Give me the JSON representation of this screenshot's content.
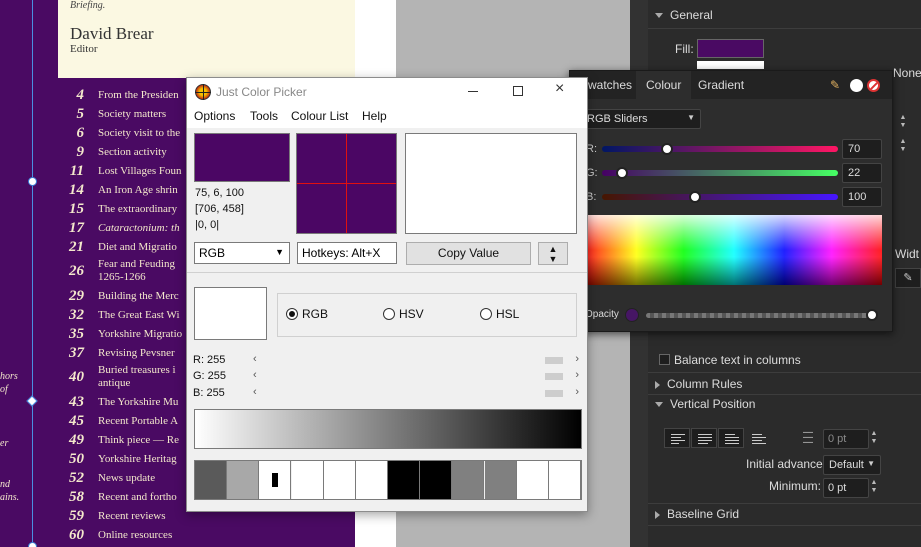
{
  "document": {
    "briefing": "Briefing.",
    "author_name": "David Brear",
    "author_role": "Editor",
    "strip_texts": [
      "hors",
      "of",
      "er",
      "nd",
      "ains."
    ],
    "toc": [
      {
        "num": "4",
        "title": "From the Presiden",
        "italic": false
      },
      {
        "num": "5",
        "title": "Society matters",
        "italic": false
      },
      {
        "num": "6",
        "title": "Society visit to the",
        "italic": false
      },
      {
        "num": "9",
        "title": "Section activity",
        "italic": false
      },
      {
        "num": "11",
        "title": "Lost Villages Foun",
        "italic": false
      },
      {
        "num": "14",
        "title": "An Iron Age shrin",
        "italic": false
      },
      {
        "num": "15",
        "title": "The extraordinary",
        "italic": false
      },
      {
        "num": "17",
        "title": "Cataractonium: th",
        "italic": true
      },
      {
        "num": "21",
        "title": "Diet and Migratio",
        "italic": false
      },
      {
        "num": "26",
        "title": "Fear and Feuding\n1265-1266",
        "italic": false
      },
      {
        "num": "29",
        "title": "Building the Merc",
        "italic": false
      },
      {
        "num": "32",
        "title": "The Great East Wi",
        "italic": false
      },
      {
        "num": "35",
        "title": "Yorkshire Migratio",
        "italic": false
      },
      {
        "num": "37",
        "title": "Revising Pevsner",
        "italic": false
      },
      {
        "num": "40",
        "title": "Buried treasures i\nantique",
        "italic": false
      },
      {
        "num": "43",
        "title": "The Yorkshire Mu",
        "italic": false
      },
      {
        "num": "45",
        "title": "Recent Portable A",
        "italic": false
      },
      {
        "num": "49",
        "title": "Think piece — Re",
        "italic": false
      },
      {
        "num": "50",
        "title": "Yorkshire Heritag",
        "italic": false
      },
      {
        "num": "52",
        "title": "News update",
        "italic": false
      },
      {
        "num": "58",
        "title": "Recent and fortho",
        "italic": false
      },
      {
        "num": "59",
        "title": "Recent reviews",
        "italic": false
      },
      {
        "num": "60",
        "title": "Online resources",
        "italic": false
      }
    ]
  },
  "jcp": {
    "title": "Just Color Picker",
    "menu": [
      "Options",
      "Tools",
      "Colour List",
      "Help"
    ],
    "rgb_text": "75, 6, 100",
    "coords_text": "[706, 458]",
    "offset_text": "|0, 0|",
    "mode_select": "RGB",
    "hotkeys": "Hotkeys: Alt+X",
    "copy_value": "Copy Value",
    "radios": [
      "RGB",
      "HSV",
      "HSL"
    ],
    "radio_selected": "RGB",
    "slider_r": "R: 255",
    "slider_g": "G: 255",
    "slider_b": "B: 255",
    "picked_color": "#4b0664",
    "history": [
      "#5a5a5a",
      "#a8a8a8",
      "#ffffff",
      "#ffffff",
      "#ffffff",
      "#ffffff",
      "#000000",
      "#000000",
      "#808080",
      "#808080",
      "#ffffff",
      "#ffffff"
    ]
  },
  "colour_panel": {
    "tabs": [
      "Swatches",
      "Colour",
      "Gradient"
    ],
    "active_tab": "Colour",
    "model": "RGB Sliders",
    "r_label": "R:",
    "g_label": "G:",
    "b_label": "B:",
    "r": 70,
    "g": 22,
    "b": 100,
    "opacity_label": "Opacity",
    "opacity": 1.0,
    "fill_color": "#461664"
  },
  "studio": {
    "general": "General",
    "fill_label": "Fill:",
    "none_label": "None",
    "width_partial": "Widt",
    "balance": "Balance text in columns",
    "column_rules": "Column Rules",
    "vertical_position": "Vertical Position",
    "pt_value1": "0 pt",
    "initial_advance_label": "Initial advance:",
    "initial_advance_value": "Default",
    "minimum_label": "Minimum:",
    "minimum_value": "0 pt",
    "baseline_grid": "Baseline Grid"
  }
}
